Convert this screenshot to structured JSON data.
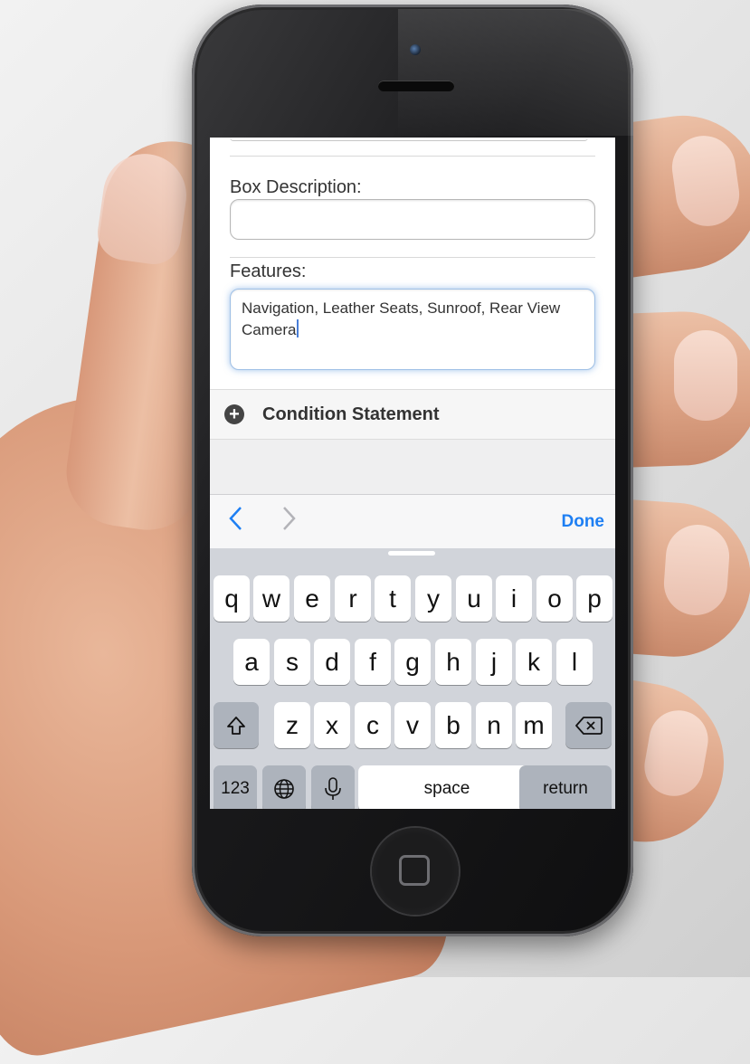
{
  "form": {
    "box_description": {
      "label": "Box Description:",
      "value": ""
    },
    "features": {
      "label": "Features:",
      "value": "Navigation, Leather Seats, Sunroof, Rear View Camera"
    },
    "condition_statement": {
      "label": "Condition Statement"
    }
  },
  "accessory_bar": {
    "prev_label": "<",
    "next_label": ">",
    "done_label": "Done"
  },
  "keyboard": {
    "row1": [
      "q",
      "w",
      "e",
      "r",
      "t",
      "y",
      "u",
      "i",
      "o",
      "p"
    ],
    "row2": [
      "a",
      "s",
      "d",
      "f",
      "g",
      "h",
      "j",
      "k",
      "l"
    ],
    "row3": [
      "z",
      "x",
      "c",
      "v",
      "b",
      "n",
      "m"
    ],
    "numbers_label": "123",
    "space_label": "space",
    "return_label": "return"
  },
  "colors": {
    "accent": "#1e7ff3",
    "keyboard_bg": "#d1d4da"
  },
  "icons": [
    "plus-circle-icon",
    "chevron-left-icon",
    "chevron-right-icon",
    "shift-icon",
    "backspace-icon",
    "globe-icon",
    "microphone-icon",
    "home-button-icon"
  ]
}
